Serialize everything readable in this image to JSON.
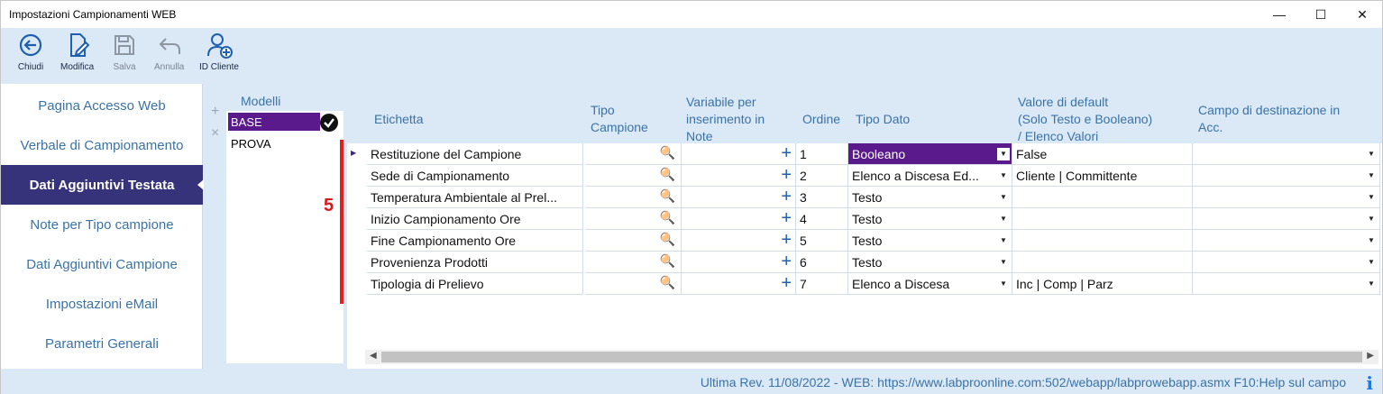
{
  "window": {
    "title": "Impostazioni Campionamenti WEB"
  },
  "toolbar": {
    "close_label": "Chiudi",
    "edit_label": "Modifica",
    "save_label": "Salva",
    "cancel_label": "Annulla",
    "client_id_label": "ID Cliente"
  },
  "sidebar": {
    "items": [
      {
        "label": "Pagina Accesso Web"
      },
      {
        "label": "Verbale di Campionamento"
      },
      {
        "label": "Dati Aggiuntivi Testata"
      },
      {
        "label": "Note per Tipo campione"
      },
      {
        "label": "Dati Aggiuntivi Campione"
      },
      {
        "label": "Impostazioni eMail"
      },
      {
        "label": "Parametri Generali"
      }
    ],
    "active_index": 2
  },
  "models": {
    "header": "Modelli",
    "items": [
      {
        "name": "BASE"
      },
      {
        "name": "PROVA"
      }
    ]
  },
  "annotation": {
    "number": "5"
  },
  "grid": {
    "headers": {
      "etichetta": "Etichetta",
      "tipo_campione_1": "Tipo",
      "tipo_campione_2": "Campione",
      "variabile_1": "Variabile per",
      "variabile_2": "inserimento in",
      "variabile_3": "Note",
      "ordine": "Ordine",
      "tipo_dato": "Tipo Dato",
      "valore_1": "Valore di default",
      "valore_2": "(Solo Testo e Booleano)",
      "valore_3": "/ Elenco Valori",
      "campo_1": "Campo di destinazione in",
      "campo_2": "Acc."
    },
    "rows": [
      {
        "etichetta": "Restituzione del Campione",
        "ordine": "1",
        "tipo_dato": "Booleano",
        "valore": "False"
      },
      {
        "etichetta": "Sede di Campionamento",
        "ordine": "2",
        "tipo_dato": "Elenco a Discesa Ed...",
        "valore": "Cliente | Committente"
      },
      {
        "etichetta": "Temperatura Ambientale al Prel...",
        "ordine": "3",
        "tipo_dato": "Testo",
        "valore": ""
      },
      {
        "etichetta": "Inizio Campionamento Ore",
        "ordine": "4",
        "tipo_dato": "Testo",
        "valore": ""
      },
      {
        "etichetta": "Fine Campionamento Ore",
        "ordine": "5",
        "tipo_dato": "Testo",
        "valore": ""
      },
      {
        "etichetta": "Provenienza Prodotti",
        "ordine": "6",
        "tipo_dato": "Testo",
        "valore": ""
      },
      {
        "etichetta": "Tipologia di Prelievo",
        "ordine": "7",
        "tipo_dato": "Elenco a Discesa",
        "valore": "Inc | Comp | Parz"
      }
    ]
  },
  "status": {
    "text": "Ultima Rev. 11/08/2022   -   WEB: https://www.labproonline.com:502/webapp/labprowebapp.asmx   F10:Help sul campo",
    "info_icon": "i"
  },
  "colors": {
    "accent": "#37337a",
    "selection": "#5a1a8c",
    "panel": "#dbe8f5",
    "link": "#3a73a8",
    "annotation": "#d41c1c"
  }
}
